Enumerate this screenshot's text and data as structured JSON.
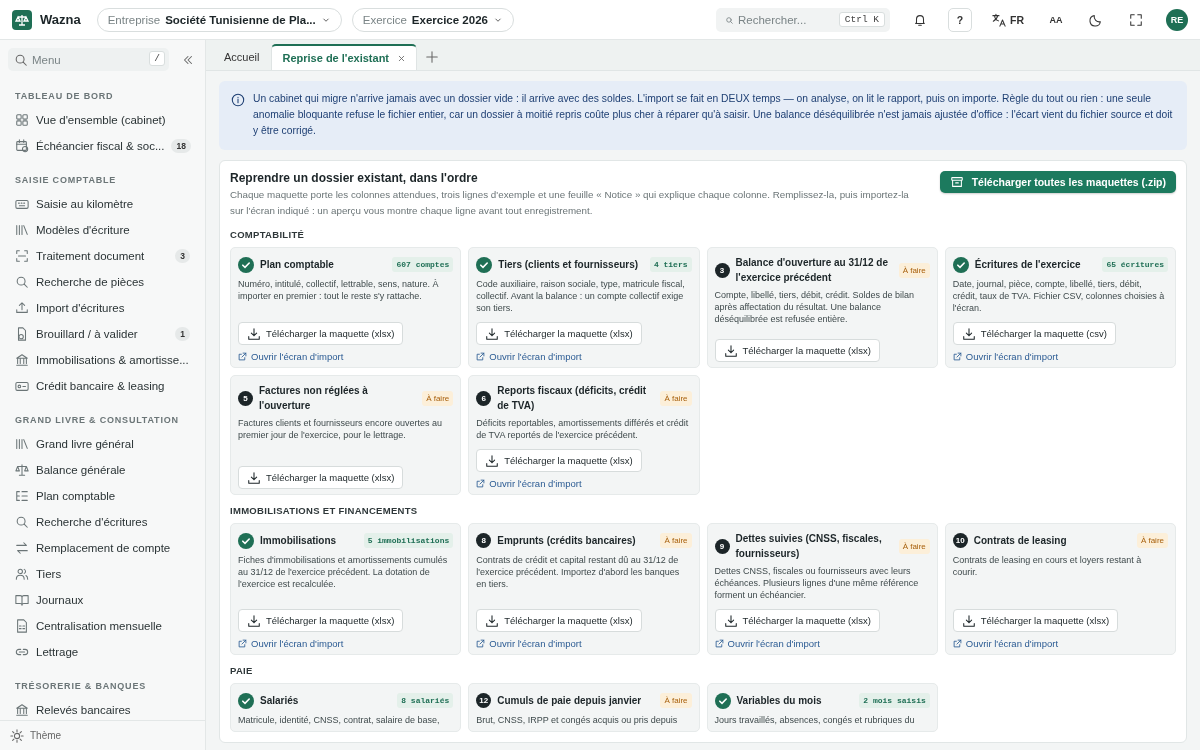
{
  "header": {
    "app_name": "Wazna",
    "company": {
      "label": "Entreprise",
      "value": "Société Tunisienne de Pla..."
    },
    "fiscal_year": {
      "label": "Exercice",
      "value": "Exercice 2026"
    },
    "search": {
      "placeholder": "Rechercher...",
      "shortcut": "Ctrl K"
    },
    "help": "?",
    "language": "FR",
    "text_size": "AA",
    "avatar": "RE"
  },
  "sidebar": {
    "search": {
      "placeholder": "Menu",
      "shortcut": "/"
    },
    "sections": [
      {
        "title": "TABLEAU DE BORD",
        "items": [
          {
            "label": "Vue d'ensemble (cabinet)",
            "selected": false
          },
          {
            "label": "Échéancier fiscal & soc...",
            "badge": "18",
            "selected": false
          }
        ]
      },
      {
        "title": "SAISIE COMPTABLE",
        "items": [
          {
            "label": "Saisie au kilomètre",
            "selected": false
          },
          {
            "label": "Modèles d'écriture",
            "selected": false
          },
          {
            "label": "Traitement document",
            "badge": "3",
            "selected": false
          },
          {
            "label": "Recherche de pièces",
            "selected": false
          },
          {
            "label": "Import d'écritures",
            "selected": false
          },
          {
            "label": "Brouillard / à valider",
            "badge": "1",
            "selected": false
          },
          {
            "label": "Immobilisations & amortisse...",
            "selected": false
          },
          {
            "label": "Crédit bancaire & leasing",
            "selected": false
          }
        ]
      },
      {
        "title": "GRAND LIVRE & CONSULTATION",
        "items": [
          {
            "label": "Grand livre général",
            "selected": false
          },
          {
            "label": "Balance générale",
            "selected": false
          },
          {
            "label": "Plan comptable",
            "selected": false
          },
          {
            "label": "Recherche d'écritures",
            "selected": false
          },
          {
            "label": "Remplacement de compte",
            "selected": false
          },
          {
            "label": "Tiers",
            "selected": false
          },
          {
            "label": "Journaux",
            "selected": false
          },
          {
            "label": "Centralisation mensuelle",
            "selected": false
          },
          {
            "label": "Lettrage",
            "selected": false
          }
        ]
      },
      {
        "title": "TRÉSORERIE & BANQUES",
        "items": [
          {
            "label": "Relevés bancaires",
            "selected": false
          }
        ]
      }
    ],
    "footer": "Thème"
  },
  "tabs": [
    {
      "label": "Accueil",
      "selected": false
    },
    {
      "label": "Reprise de l'existant",
      "selected": true
    }
  ],
  "info": "Un cabinet qui migre n'arrive jamais avec un dossier vide : il arrive avec des soldes. L'import se fait en DEUX temps — on analyse, on lit le rapport, puis on importe. Règle du tout ou rien : une seule anomalie bloquante refuse le fichier entier, car un dossier à moitié repris coûte plus cher à réparer qu'à saisir. Une balance déséquilibrée n'est jamais ajustée d'office : l'écart vient du fichier source et doit y être corrigé.",
  "panel": {
    "title": "Reprendre un dossier existant, dans l'ordre",
    "description": "Chaque maquette porte les colonnes attendues, trois lignes d'exemple et une feuille « Notice » qui explique chaque colonne. Remplissez-la, puis importez-la sur l'écran indiqué : un aperçu vous montre chaque ligne avant tout enregistrement.",
    "download_all": "Télécharger toutes les maquettes (.zip)",
    "groups": [
      {
        "title": "COMPTABILITÉ",
        "cards": [
          {
            "kind": "done",
            "title": "Plan comptable",
            "badge": "607 comptes",
            "description": "Numéro, intitulé, collectif, lettrable, sens, nature. À importer en premier : tout le reste s'y rattache.",
            "download": "Télécharger la maquette (xlsx)",
            "import_link": "Ouvrir l'écran d'import"
          },
          {
            "kind": "done",
            "title": "Tiers (clients et fournisseurs)",
            "badge": "4 tiers",
            "description": "Code auxiliaire, raison sociale, type, matricule fiscal, collectif. Avant la balance : un compte collectif exige son tiers.",
            "download": "Télécharger la maquette (xlsx)",
            "import_link": "Ouvrir l'écran d'import"
          },
          {
            "kind": "todo",
            "step": "3",
            "title": "Balance d'ouverture au 31/12 de l'exercice précédent",
            "badge": "À faire",
            "description": "Compte, libellé, tiers, débit, crédit. Soldes de bilan après affectation du résultat. Une balance déséquilibrée est refusée entière.",
            "download": "Télécharger la maquette (xlsx)"
          },
          {
            "kind": "done",
            "title": "Écritures de l'exercice",
            "badge": "65 écritures",
            "description": "Date, journal, pièce, compte, libellé, tiers, débit, crédit, taux de TVA. Fichier CSV, colonnes choisies à l'écran.",
            "download": "Télécharger la maquette (csv)",
            "import_link": "Ouvrir l'écran d'import"
          },
          {
            "kind": "todo",
            "step": "5",
            "title": "Factures non réglées à l'ouverture",
            "badge": "À faire",
            "description": "Factures clients et fournisseurs encore ouvertes au premier jour de l'exercice, pour le lettrage.",
            "download": "Télécharger la maquette (xlsx)"
          },
          {
            "kind": "todo",
            "step": "6",
            "title": "Reports fiscaux (déficits, crédit de TVA)",
            "badge": "À faire",
            "description": "Déficits reportables, amortissements différés et crédit de TVA reportés de l'exercice précédent.",
            "download": "Télécharger la maquette (xlsx)",
            "import_link": "Ouvrir l'écran d'import"
          }
        ]
      },
      {
        "title": "IMMOBILISATIONS ET FINANCEMENTS",
        "cards": [
          {
            "kind": "done",
            "title": "Immobilisations",
            "badge": "5 immobilisations",
            "description": "Fiches d'immobilisations et amortissements cumulés au 31/12 de l'exercice précédent. La dotation de l'exercice est recalculée.",
            "download": "Télécharger la maquette (xlsx)",
            "import_link": "Ouvrir l'écran d'import"
          },
          {
            "kind": "todo",
            "step": "8",
            "title": "Emprunts (crédits bancaires)",
            "badge": "À faire",
            "description": "Contrats de crédit et capital restant dû au 31/12 de l'exercice précédent. Importez d'abord les banques en tiers.",
            "download": "Télécharger la maquette (xlsx)",
            "import_link": "Ouvrir l'écran d'import"
          },
          {
            "kind": "todo",
            "step": "9",
            "title": "Dettes suivies (CNSS, fiscales, fournisseurs)",
            "badge": "À faire",
            "description": "Dettes CNSS, fiscales ou fournisseurs avec leurs échéances. Plusieurs lignes d'une même référence forment un échéancier.",
            "download": "Télécharger la maquette (xlsx)",
            "import_link": "Ouvrir l'écran d'import"
          },
          {
            "kind": "todo",
            "step": "10",
            "title": "Contrats de leasing",
            "badge": "À faire",
            "description": "Contrats de leasing en cours et loyers restant à courir.",
            "download": "Télécharger la maquette (xlsx)",
            "import_link": "Ouvrir l'écran d'import"
          }
        ]
      },
      {
        "title": "PAIE",
        "cards": [
          {
            "kind": "done",
            "title": "Salariés",
            "badge": "8 salariés",
            "description": "Matricule, identité, CNSS, contrat, salaire de base,"
          },
          {
            "kind": "todo",
            "step": "12",
            "title": "Cumuls de paie depuis janvier",
            "badge": "À faire",
            "description": "Brut, CNSS, IRPP et congés acquis ou pris depuis"
          },
          {
            "kind": "done",
            "title": "Variables du mois",
            "badge": "2 mois saisis",
            "description": "Jours travaillés, absences, congés et rubriques du"
          }
        ]
      }
    ]
  }
}
